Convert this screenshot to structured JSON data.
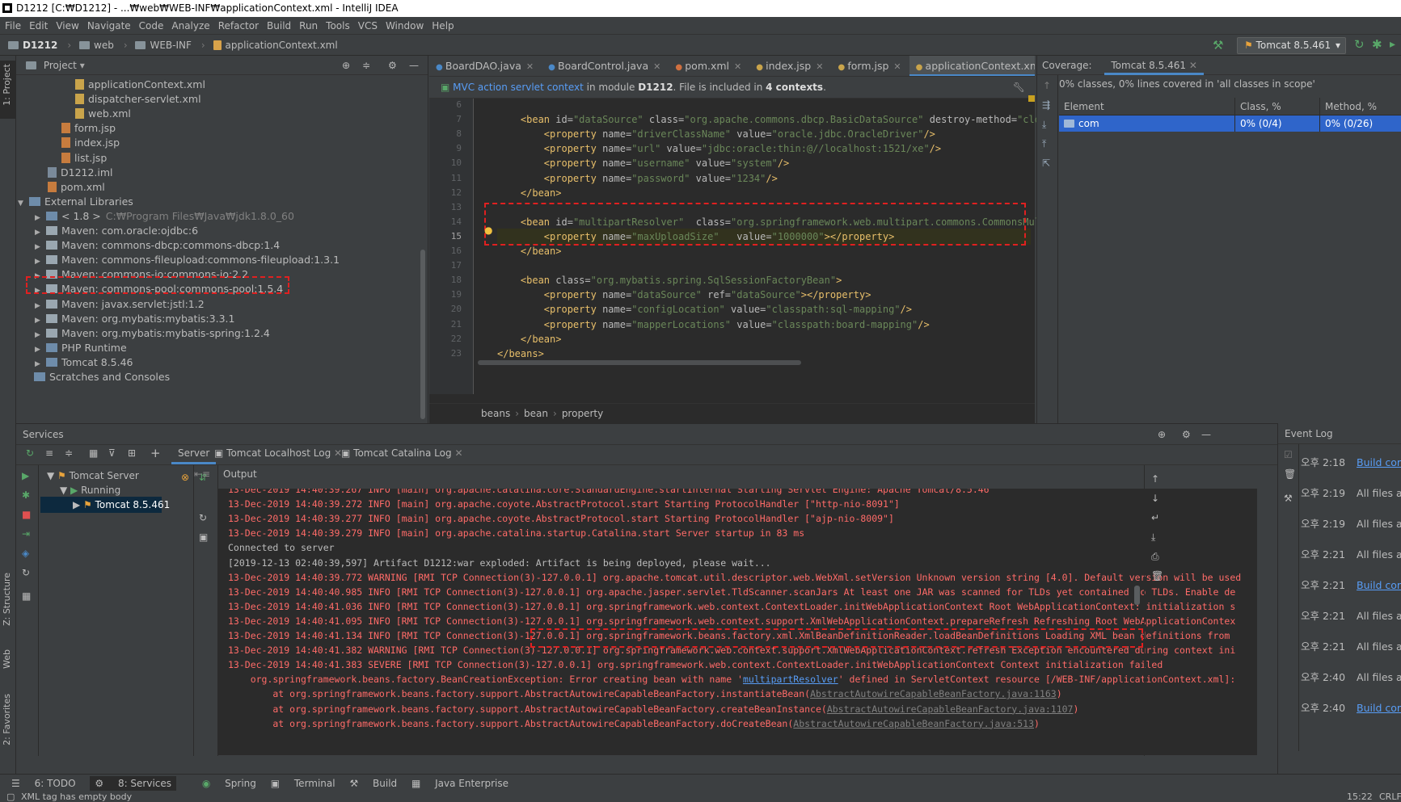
{
  "window": {
    "title": "D1212 [C:₩D1212] - ...₩web₩WEB-INF₩applicationContext.xml - IntelliJ IDEA"
  },
  "menu": [
    "File",
    "Edit",
    "View",
    "Navigate",
    "Code",
    "Analyze",
    "Refactor",
    "Build",
    "Run",
    "Tools",
    "VCS",
    "Window",
    "Help"
  ],
  "breadcrumb": [
    "D1212",
    "web",
    "WEB-INF",
    "applicationContext.xml"
  ],
  "run_config": "Tomcat 8.5.461",
  "project": {
    "header": "Project",
    "items": [
      {
        "label": "applicationContext.xml",
        "icon": "xml",
        "indent": 3
      },
      {
        "label": "dispatcher-servlet.xml",
        "icon": "xml",
        "indent": 3
      },
      {
        "label": "web.xml",
        "icon": "xml",
        "indent": 3
      },
      {
        "label": "form.jsp",
        "icon": "jsp",
        "indent": 2
      },
      {
        "label": "index.jsp",
        "icon": "jsp",
        "indent": 2
      },
      {
        "label": "list.jsp",
        "icon": "jsp",
        "indent": 2
      },
      {
        "label": "D1212.iml",
        "icon": "iml",
        "indent": 1
      },
      {
        "label": "pom.xml",
        "icon": "pom",
        "indent": 1
      },
      {
        "label": "External Libraries",
        "icon": "lib",
        "indent": 0
      },
      {
        "label": "< 1.8 >",
        "sub": "C:₩Program Files₩Java₩jdk1.8.0_60",
        "icon": "jdk",
        "indent": 1
      },
      {
        "label": "Maven: com.oracle:ojdbc:6",
        "icon": "jar",
        "indent": 1
      },
      {
        "label": "Maven: commons-dbcp:commons-dbcp:1.4",
        "icon": "jar",
        "indent": 1
      },
      {
        "label": "Maven: commons-fileupload:commons-fileupload:1.3.1",
        "icon": "jar",
        "indent": 1
      },
      {
        "label": "Maven: commons-io:commons-io:2.2",
        "icon": "jar",
        "indent": 1
      },
      {
        "label": "Maven: commons-pool:commons-pool:1.5.4",
        "icon": "jar",
        "indent": 1
      },
      {
        "label": "Maven: javax.servlet:jstl:1.2",
        "icon": "jar",
        "indent": 1
      },
      {
        "label": "Maven: org.mybatis:mybatis:3.3.1",
        "icon": "jar",
        "indent": 1
      },
      {
        "label": "Maven: org.mybatis:mybatis-spring:1.2.4",
        "icon": "jar",
        "indent": 1
      },
      {
        "label": "PHP Runtime",
        "icon": "lib",
        "indent": 1
      },
      {
        "label": "Tomcat 8.5.46",
        "icon": "lib",
        "indent": 1
      },
      {
        "label": "Scratches and Consoles",
        "icon": "scratch",
        "indent": 0
      }
    ]
  },
  "editor": {
    "tabs": [
      {
        "label": "BoardDAO.java",
        "active": false
      },
      {
        "label": "BoardControl.java",
        "active": false
      },
      {
        "label": "pom.xml",
        "active": false
      },
      {
        "label": "index.jsp",
        "active": false
      },
      {
        "label": "form.jsp",
        "active": false
      },
      {
        "label": "applicationContext.xml",
        "active": true
      }
    ],
    "banner_link": "MVC action servlet context",
    "banner_text_1": " in module ",
    "banner_module": "D1212",
    "banner_text_2": ". File is included in ",
    "banner_count": "4 contexts",
    "banner_text_3": ".",
    "line_numbers": [
      "6",
      "7",
      "8",
      "9",
      "10",
      "11",
      "12",
      "13",
      "14",
      "15",
      "16",
      "17",
      "18",
      "19",
      "20",
      "21",
      "22",
      "23"
    ],
    "code": [
      "",
      "    <bean id=\"dataSource\" class=\"org.apache.commons.dbcp.BasicDataSource\" destroy-method=\"close\">",
      "        <property name=\"driverClassName\" value=\"oracle.jdbc.OracleDriver\"/>",
      "        <property name=\"url\" value=\"jdbc:oracle:thin:@//localhost:1521/xe\"/>",
      "        <property name=\"username\" value=\"system\"/>",
      "        <property name=\"password\" value=\"1234\"/>",
      "    </bean>",
      "",
      "    <bean id=\"multipartResolver\"  class=\"org.springframework.web.multipart.commons.CommonsMultipar",
      "        <property name=\"maxUploadSize\"   value=\"1000000\"></property>",
      "    </bean>",
      "",
      "    <bean class=\"org.mybatis.spring.SqlSessionFactoryBean\">",
      "        <property name=\"dataSource\" ref=\"dataSource\"></property>",
      "        <property name=\"configLocation\" value=\"classpath:sql-mapping\"/>",
      "        <property name=\"mapperLocations\" value=\"classpath:board-mapping\"/>",
      "    </bean>",
      "</beans>"
    ],
    "breadcrumbs": [
      "beans",
      "bean",
      "property"
    ]
  },
  "coverage": {
    "label": "Coverage:",
    "tab": "Tomcat 8.5.461",
    "summary": "0% classes, 0% lines covered in 'all classes in scope'",
    "columns": [
      "Element",
      "Class, %",
      "Method, %"
    ],
    "rows": [
      {
        "element": "com",
        "class": "0% (0/4)",
        "method": "0% (0/26)"
      }
    ]
  },
  "services": {
    "title": "Services",
    "tabs": [
      "Server",
      "Tomcat Localhost Log",
      "Tomcat Catalina Log"
    ],
    "output_label": "Output",
    "tree": [
      {
        "label": "Tomcat Server",
        "indent": 0
      },
      {
        "label": "Running",
        "indent": 1
      },
      {
        "label": "Tomcat 8.5.461",
        "indent": 2,
        "selected": true
      }
    ],
    "log": [
      {
        "t": "13-Dec-2019 14:40:39.267 INFO [main] org.apache.catalina.core.StandardEngine.startInternal Starting Servlet Engine: Apache Tomcat/8.5.46",
        "c": "err"
      },
      {
        "t": "13-Dec-2019 14:40:39.272 INFO [main] org.apache.coyote.AbstractProtocol.start Starting ProtocolHandler [\"http-nio-8091\"]",
        "c": "err"
      },
      {
        "t": "13-Dec-2019 14:40:39.277 INFO [main] org.apache.coyote.AbstractProtocol.start Starting ProtocolHandler [\"ajp-nio-8009\"]",
        "c": "err"
      },
      {
        "t": "13-Dec-2019 14:40:39.279 INFO [main] org.apache.catalina.startup.Catalina.start Server startup in 83 ms",
        "c": "err"
      },
      {
        "t": "Connected to server",
        "c": "ok"
      },
      {
        "t": "[2019-12-13 02:40:39,597] Artifact D1212:war exploded: Artifact is being deployed, please wait...",
        "c": "ok"
      },
      {
        "t": "13-Dec-2019 14:40:39.772 WARNING [RMI TCP Connection(3)-127.0.0.1] org.apache.tomcat.util.descriptor.web.WebXml.setVersion Unknown version string [4.0]. Default version will be used",
        "c": "err"
      },
      {
        "t": "13-Dec-2019 14:40:40.985 INFO [RMI TCP Connection(3)-127.0.0.1] org.apache.jasper.servlet.TldScanner.scanJars At least one JAR was scanned for TLDs yet contained no TLDs. Enable de",
        "c": "err"
      },
      {
        "t": "13-Dec-2019 14:40:41.036 INFO [RMI TCP Connection(3)-127.0.0.1] org.springframework.web.context.ContextLoader.initWebApplicationContext Root WebApplicationContext: initialization s",
        "c": "err"
      },
      {
        "t": "13-Dec-2019 14:40:41.095 INFO [RMI TCP Connection(3)-127.0.0.1] org.springframework.web.context.support.XmlWebApplicationContext.prepareRefresh Refreshing Root WebApplicationContex",
        "c": "err"
      },
      {
        "t": "13-Dec-2019 14:40:41.134 INFO [RMI TCP Connection(3)-127.0.0.1] org.springframework.beans.factory.xml.XmlBeanDefinitionReader.loadBeanDefinitions Loading XML bean definitions from",
        "c": "err"
      },
      {
        "t": "13-Dec-2019 14:40:41.382 WARNING [RMI TCP Connection(3)-127.0.0.1] org.springframework.web.context.support.XmlWebApplicationContext.refresh Exception encountered during context ini",
        "c": "err"
      },
      {
        "t": "13-Dec-2019 14:40:41.383 SEVERE [RMI TCP Connection(3)-127.0.0.1] org.springframework.web.context.ContextLoader.initWebApplicationContext Context initialization failed",
        "c": "err"
      }
    ],
    "exception_prefix": "    org.springframework.beans.factory.BeanCreationException: ",
    "exception_msg_1": "Error creating bean with name '",
    "exception_link": "multipartResolver",
    "exception_msg_2": "' defined in ServletContext resource [/WEB-INF/applicationContext.xml]:",
    "stack": [
      {
        "pre": "        at org.springframework.beans.factory.support.AbstractAutowireCapableBeanFactory.instantiateBean(",
        "link": "AbstractAutowireCapableBeanFactory.java:1163",
        "post": ")"
      },
      {
        "pre": "        at org.springframework.beans.factory.support.AbstractAutowireCapableBeanFactory.createBeanInstance(",
        "link": "AbstractAutowireCapableBeanFactory.java:1107",
        "post": ")"
      },
      {
        "pre": "        at org.springframework.beans.factory.support.AbstractAutowireCapableBeanFactory.doCreateBean(",
        "link": "AbstractAutowireCapableBeanFactory.java:513",
        "post": ")"
      }
    ]
  },
  "event_log": {
    "title": "Event Log",
    "entries": [
      {
        "time": "오후 2:18",
        "text": "Build comp",
        "link": true
      },
      {
        "time": "오후 2:19",
        "text": "All files are",
        "link": false
      },
      {
        "time": "오후 2:19",
        "text": "All files are",
        "link": false
      },
      {
        "time": "오후 2:21",
        "text": "All files are",
        "link": false
      },
      {
        "time": "오후 2:21",
        "text": "Build comp",
        "link": true
      },
      {
        "time": "오후 2:21",
        "text": "All files are",
        "link": false
      },
      {
        "time": "오후 2:21",
        "text": "All files are",
        "link": false
      },
      {
        "time": "오후 2:40",
        "text": "All files are",
        "link": false
      },
      {
        "time": "오후 2:40",
        "text": "Build comp",
        "link": true
      }
    ]
  },
  "bottom_tabs": [
    "6: TODO",
    "8: Services",
    "Spring",
    "Terminal",
    "Build",
    "Java Enterprise"
  ],
  "status": {
    "message": "XML tag has empty body",
    "position": "15:22",
    "encoding": "CRLF"
  },
  "left_vtabs": [
    "1: Project",
    "Z: Structure",
    "Web",
    "2: Favorites"
  ]
}
